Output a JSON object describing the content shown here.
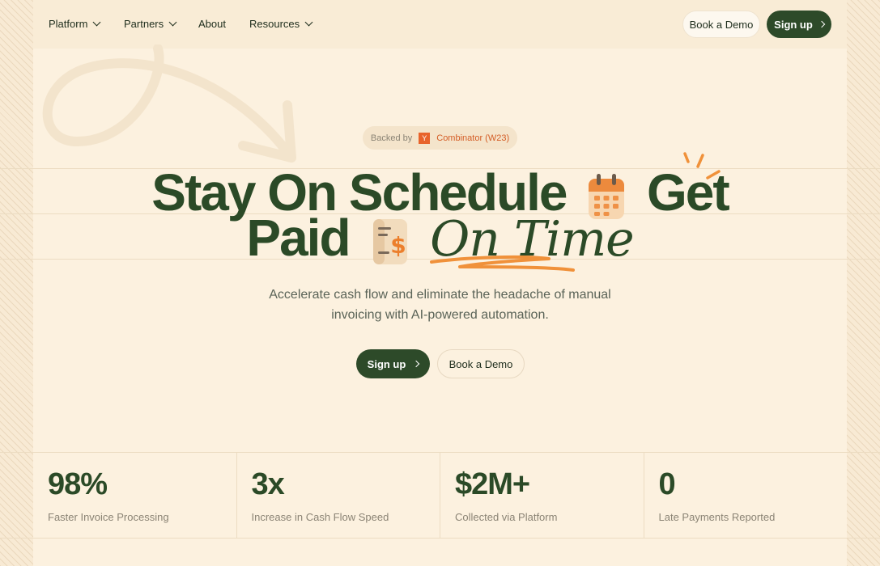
{
  "nav": {
    "items": [
      {
        "label": "Platform",
        "dropdown": true
      },
      {
        "label": "Partners",
        "dropdown": true
      },
      {
        "label": "About",
        "dropdown": false
      },
      {
        "label": "Resources",
        "dropdown": true
      }
    ],
    "book_demo": "Book a Demo",
    "sign_up": "Sign up"
  },
  "badge": {
    "prefix": "Backed by",
    "logo": "Y",
    "text": "Combinator (W23)"
  },
  "hero": {
    "line1_a": "Stay On Schedule",
    "line1_b": "Get",
    "line2_a": "Paid",
    "line2_b": "On Time",
    "icons": [
      "calendar-icon",
      "invoice-dollar-icon"
    ],
    "subtitle_1": "Accelerate cash flow and eliminate the headache of manual",
    "subtitle_2": "invoicing with AI-powered automation.",
    "cta_primary": "Sign up",
    "cta_secondary": "Book a Demo"
  },
  "stats": [
    {
      "value": "98%",
      "label": "Faster Invoice Processing"
    },
    {
      "value": "3x",
      "label": "Increase in Cash Flow Speed"
    },
    {
      "value": "$2M+",
      "label": "Collected via Platform"
    },
    {
      "value": "0",
      "label": "Late Payments Reported"
    }
  ],
  "colors": {
    "background": "#fcf1df",
    "brand_green": "#2d4a29",
    "accent_orange": "#f0913a",
    "yc_orange": "#e8632b"
  }
}
